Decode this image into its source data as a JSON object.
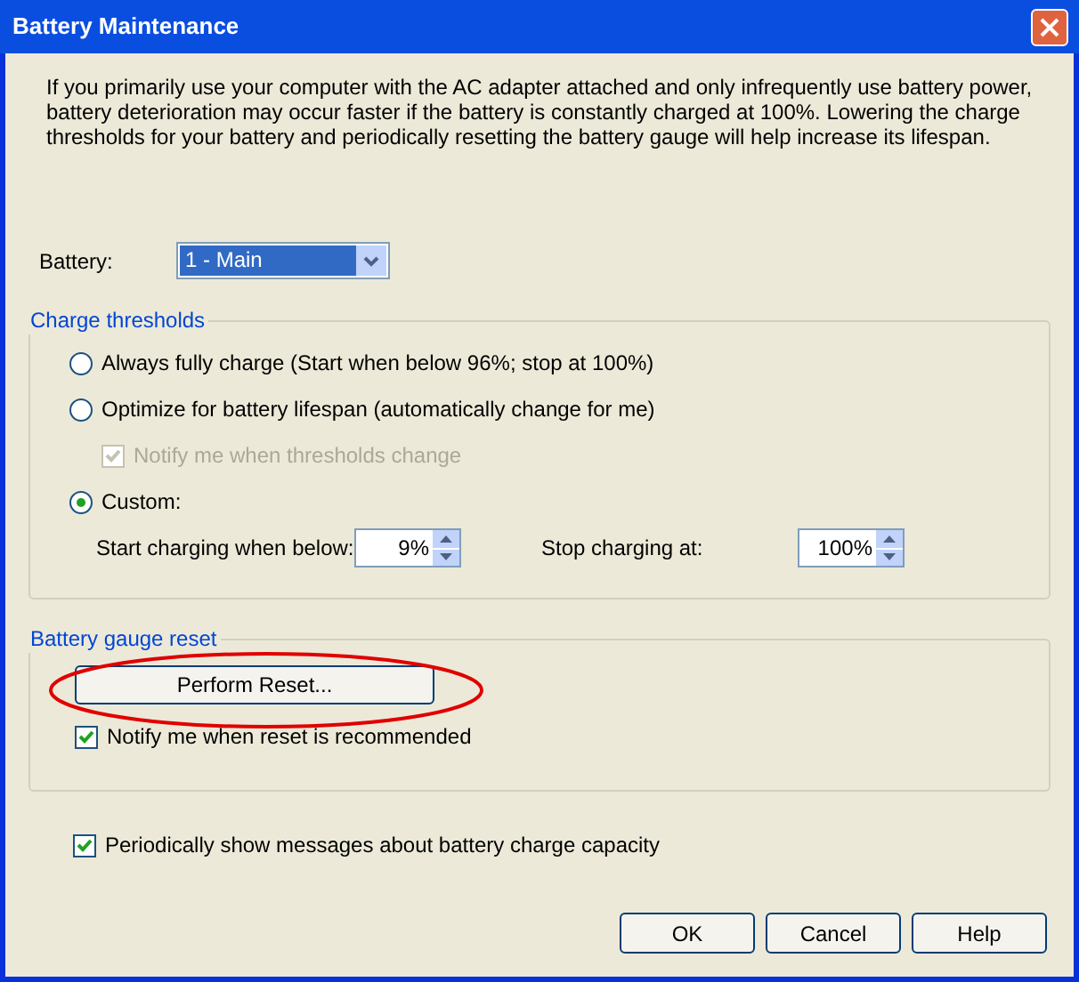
{
  "window": {
    "title": "Battery Maintenance"
  },
  "description": "If you primarily use your computer with the AC adapter attached and only infrequently use battery power, battery deterioration may occur faster if the battery is constantly charged at 100%. Lowering the charge thresholds for your battery and periodically resetting the battery gauge will help increase its lifespan.",
  "battery": {
    "label": "Battery:",
    "value": "1 - Main"
  },
  "charge_thresholds": {
    "title": "Charge thresholds",
    "options": [
      {
        "kind": "radio",
        "label": "Always fully charge (Start when below 96%; stop at 100%)",
        "selected": false,
        "disabled": false
      },
      {
        "kind": "radio",
        "label": "Optimize for battery lifespan (automatically change for me)",
        "selected": false,
        "disabled": false
      },
      {
        "kind": "checkbox",
        "label": "Notify me when thresholds change",
        "checked": true,
        "disabled": true
      },
      {
        "kind": "radio",
        "label": "Custom:",
        "selected": true,
        "disabled": false
      }
    ],
    "start": {
      "label": "Start charging when below:",
      "value": "9%"
    },
    "stop": {
      "label": "Stop charging at:",
      "value": "100%"
    }
  },
  "gauge_reset": {
    "title": "Battery gauge reset",
    "button": "Perform Reset...",
    "highlighted": true,
    "notify": {
      "label": "Notify me when reset is recommended",
      "checked": true
    }
  },
  "periodic": {
    "label": "Periodically show messages about battery charge capacity",
    "checked": true
  },
  "buttons": [
    "OK",
    "Cancel",
    "Help"
  ]
}
